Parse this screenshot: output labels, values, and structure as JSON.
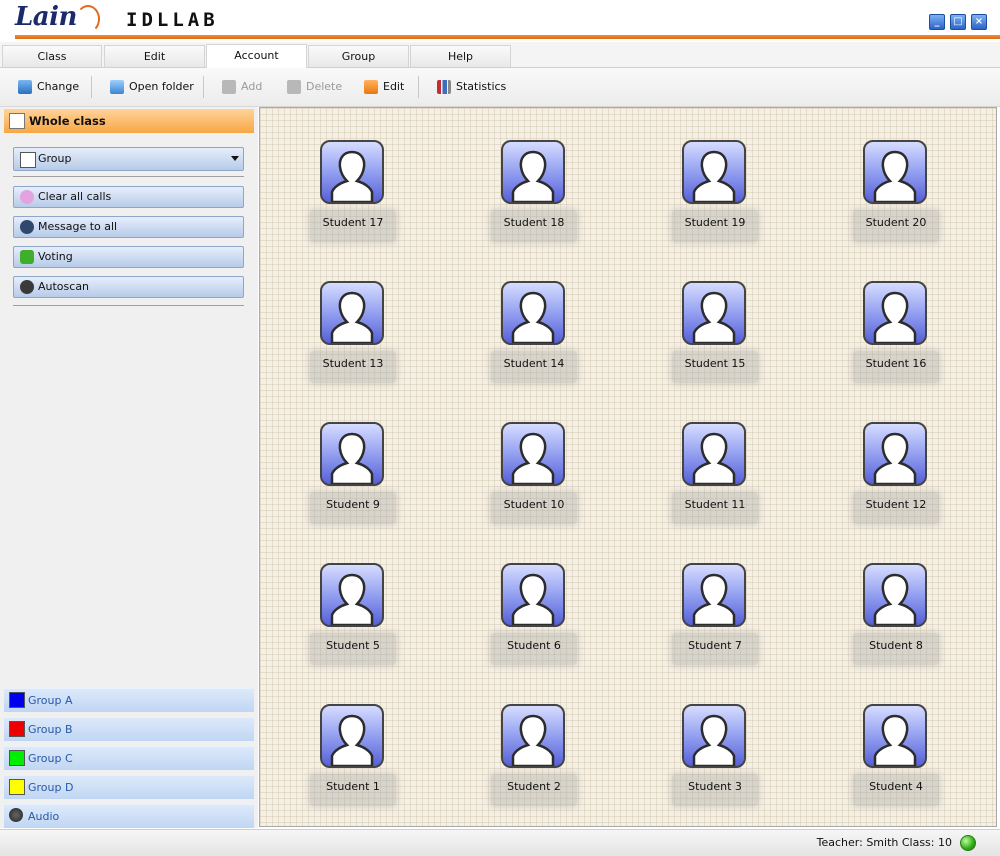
{
  "app": {
    "brand": "Lain",
    "product": "IDLLAB"
  },
  "window_controls": {
    "minimize": "_",
    "maximize": "□",
    "close": "×"
  },
  "menu": {
    "tabs": [
      {
        "label": "Class",
        "active": false
      },
      {
        "label": "Edit",
        "active": false
      },
      {
        "label": "Account",
        "active": true
      },
      {
        "label": "Group",
        "active": false
      },
      {
        "label": "Help",
        "active": false
      }
    ]
  },
  "toolbar": {
    "items": [
      {
        "label": "Change",
        "icon": "change-icon",
        "enabled": true
      },
      {
        "label": "Open folder",
        "icon": "folder-icon",
        "enabled": true
      },
      {
        "label": "Add",
        "icon": "add-icon",
        "enabled": false
      },
      {
        "label": "Delete",
        "icon": "delete-icon",
        "enabled": false
      },
      {
        "label": "Edit",
        "icon": "edit-icon",
        "enabled": true
      },
      {
        "label": "Statistics",
        "icon": "statistics-icon",
        "enabled": true
      }
    ]
  },
  "sidebar": {
    "whole_class": "Whole class",
    "group_select": "Group",
    "actions": [
      {
        "label": "Clear all calls",
        "icon": "clear-calls-icon",
        "color": "#d98ad6"
      },
      {
        "label": "Message to all",
        "icon": "message-icon",
        "color": "#30476e"
      },
      {
        "label": "Voting",
        "icon": "voting-icon",
        "color": "#3fae2a"
      },
      {
        "label": "Autoscan",
        "icon": "autoscan-icon",
        "color": "#3a3a3a"
      }
    ],
    "groups": [
      {
        "label": "Group A",
        "color": "#0000ee"
      },
      {
        "label": "Group B",
        "color": "#ee0000"
      },
      {
        "label": "Group C",
        "color": "#00ee00"
      },
      {
        "label": "Group D",
        "color": "#ffff00"
      }
    ],
    "audio": "Audio"
  },
  "students": [
    [
      "Student 17",
      "Student 18",
      "Student 19",
      "Student 20"
    ],
    [
      "Student 13",
      "Student 14",
      "Student 15",
      "Student 16"
    ],
    [
      "Student 9",
      "Student 10",
      "Student 11",
      "Student 12"
    ],
    [
      "Student 5",
      "Student 6",
      "Student 7",
      "Student 8"
    ],
    [
      "Student 1",
      "Student 2",
      "Student 3",
      "Student 4"
    ]
  ],
  "status": {
    "text": "Teacher: Smith  Class: 10",
    "connected_color": "#2faa16"
  }
}
